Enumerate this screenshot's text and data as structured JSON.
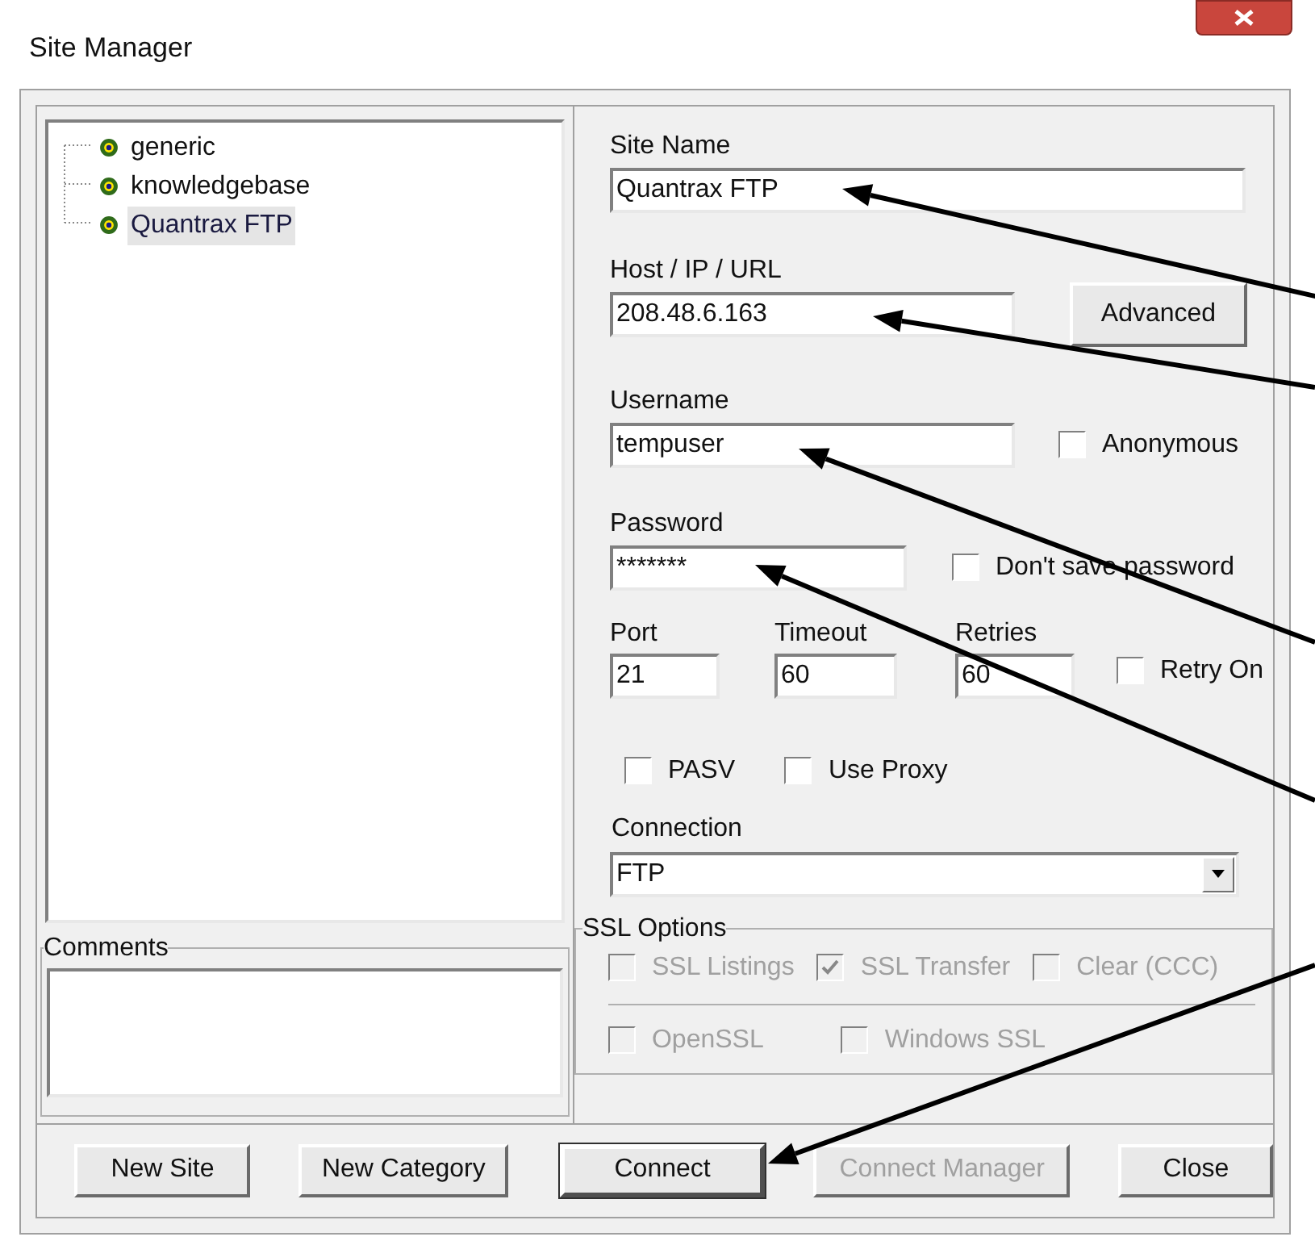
{
  "window": {
    "title": "Site Manager"
  },
  "sites": [
    {
      "label": "generic",
      "selected": false
    },
    {
      "label": "knowledgebase",
      "selected": false
    },
    {
      "label": "Quantrax FTP",
      "selected": true
    }
  ],
  "site_name": {
    "label": "Site Name",
    "value": "Quantrax FTP"
  },
  "host": {
    "label": "Host / IP / URL",
    "value": "208.48.6.163"
  },
  "advanced_button": "Advanced",
  "username": {
    "label": "Username",
    "value": "tempuser"
  },
  "anonymous": {
    "label": "Anonymous",
    "checked": false
  },
  "password": {
    "label": "Password",
    "value": "*******"
  },
  "dont_save_password": {
    "label": "Don't save password",
    "checked": false
  },
  "port": {
    "label": "Port",
    "value": "21"
  },
  "timeout": {
    "label": "Timeout",
    "value": "60"
  },
  "retries": {
    "label": "Retries",
    "value": "60"
  },
  "retry_on": {
    "label": "Retry On",
    "checked": false
  },
  "pasv": {
    "label": "PASV",
    "checked": false
  },
  "use_proxy": {
    "label": "Use Proxy",
    "checked": false
  },
  "connection": {
    "label": "Connection",
    "value": "FTP"
  },
  "comments": {
    "label": "Comments"
  },
  "ssl_options": {
    "label": "SSL Options",
    "row_1": [
      {
        "label": "SSL Listings",
        "checked": false,
        "disabled": true
      },
      {
        "label": "SSL Transfer",
        "checked": true,
        "disabled": true
      },
      {
        "label": "Clear (CCC)",
        "checked": false,
        "disabled": true
      }
    ],
    "row_2": [
      {
        "label": "OpenSSL",
        "checked": false,
        "disabled": true
      },
      {
        "label": "Windows SSL",
        "checked": false,
        "disabled": true
      }
    ]
  },
  "buttons": [
    {
      "label": "New Site",
      "disabled": false,
      "default": false
    },
    {
      "label": "New Category",
      "disabled": false,
      "default": false
    },
    {
      "label": "Connect",
      "disabled": false,
      "default": true
    },
    {
      "label": "Connect Manager",
      "disabled": true,
      "default": false
    },
    {
      "label": "Close",
      "disabled": false,
      "default": false
    }
  ]
}
